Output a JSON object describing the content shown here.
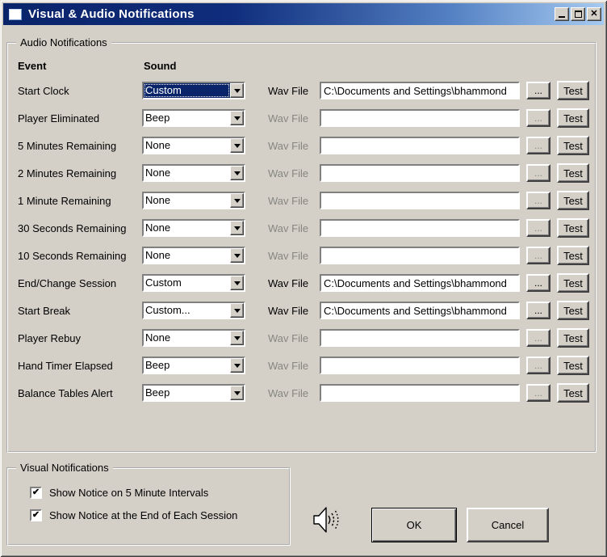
{
  "window": {
    "title": "Visual & Audio Notifications"
  },
  "icons": {
    "minimize": "_",
    "maximize": "□",
    "close": "✕",
    "dropdown": "▼",
    "check": "✔",
    "speaker": "speaker-with-sound-waves"
  },
  "colors": {
    "titlebar_start": "#0a246a",
    "titlebar_end": "#a6caf0",
    "base": "#d4d0c8",
    "selection_bg": "#0a246a",
    "selection_fg": "#ffffff",
    "disabled_text": "#868681"
  },
  "audio_section": {
    "legend": "Audio Notifications",
    "columns": {
      "event": "Event",
      "sound": "Sound"
    },
    "wav_file_label": "Wav File",
    "browse_label": "...",
    "test_label": "Test",
    "rows": [
      {
        "event": "Start Clock",
        "sound": "Custom",
        "wav_file": "C:\\Documents and Settings\\bhammond",
        "wav_enabled": true,
        "selected": true
      },
      {
        "event": "Player Eliminated",
        "sound": "Beep",
        "wav_file": "",
        "wav_enabled": false,
        "selected": false
      },
      {
        "event": "5 Minutes Remaining",
        "sound": "None",
        "wav_file": "",
        "wav_enabled": false,
        "selected": false
      },
      {
        "event": "2 Minutes Remaining",
        "sound": "None",
        "wav_file": "",
        "wav_enabled": false,
        "selected": false
      },
      {
        "event": "1 Minute Remaining",
        "sound": "None",
        "wav_file": "",
        "wav_enabled": false,
        "selected": false
      },
      {
        "event": "30 Seconds Remaining",
        "sound": "None",
        "wav_file": "",
        "wav_enabled": false,
        "selected": false
      },
      {
        "event": "10 Seconds Remaining",
        "sound": "None",
        "wav_file": "",
        "wav_enabled": false,
        "selected": false
      },
      {
        "event": "End/Change Session",
        "sound": "Custom",
        "wav_file": "C:\\Documents and Settings\\bhammond",
        "wav_enabled": true,
        "selected": false
      },
      {
        "event": "Start Break",
        "sound": "Custom...",
        "wav_file": "C:\\Documents and Settings\\bhammond",
        "wav_enabled": true,
        "selected": false
      },
      {
        "event": "Player Rebuy",
        "sound": "None",
        "wav_file": "",
        "wav_enabled": false,
        "selected": false
      },
      {
        "event": "Hand Timer Elapsed",
        "sound": "Beep",
        "wav_file": "",
        "wav_enabled": false,
        "selected": false
      },
      {
        "event": "Balance Tables Alert",
        "sound": "Beep",
        "wav_file": "",
        "wav_enabled": false,
        "selected": false
      }
    ]
  },
  "visual_section": {
    "legend": "Visual Notifications",
    "checkboxes": [
      {
        "label": "Show Notice on 5 Minute Intervals",
        "checked": true
      },
      {
        "label": "Show Notice at the End of Each Session",
        "checked": true
      }
    ]
  },
  "footer": {
    "ok_label": "OK",
    "cancel_label": "Cancel"
  }
}
